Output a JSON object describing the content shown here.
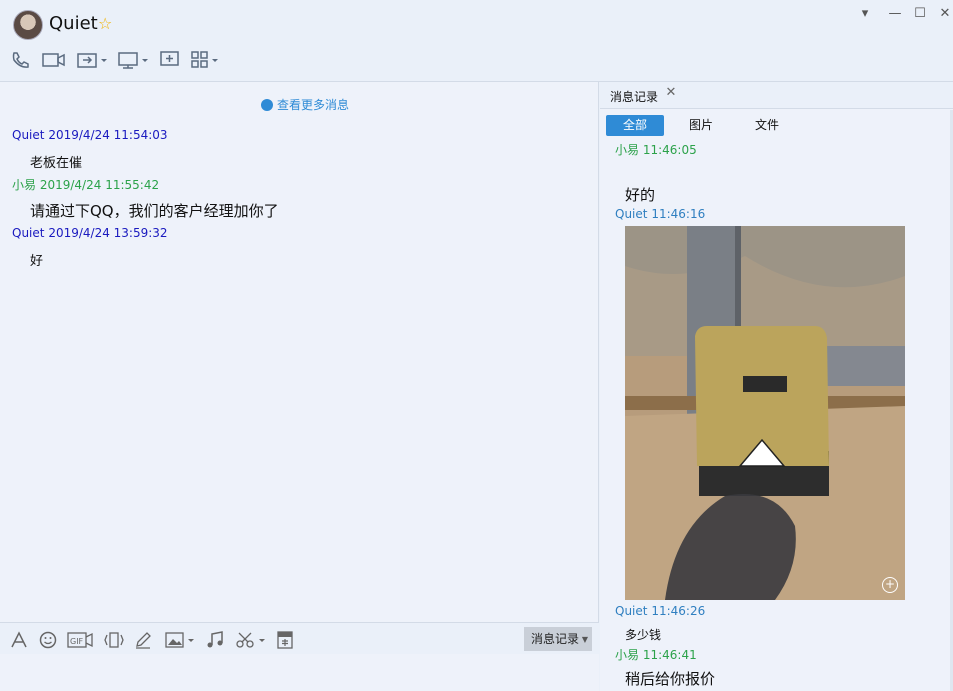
{
  "header": {
    "contact_name": "Quiet",
    "window_controls": [
      "chevron-down-icon",
      "minimize-icon",
      "maximize-icon",
      "close-icon"
    ],
    "toolbar_icons": [
      "phone-icon",
      "video-icon",
      "file-transfer-icon",
      "screen-share-icon",
      "add-chat-icon",
      "apps-icon"
    ]
  },
  "chat": {
    "more_messages": "查看更多消息",
    "messages": [
      {
        "sender": "Quiet",
        "time": "2019/4/24 11:54:03",
        "text": "老板在催"
      },
      {
        "sender": "小易",
        "time": "2019/4/24 11:55:42",
        "text": "请通过下QQ，我们的客户经理加你了"
      },
      {
        "sender": "Quiet",
        "time": "2019/4/24 13:59:32",
        "text": "好"
      }
    ]
  },
  "input_toolbar": {
    "icons": [
      "font-icon",
      "emoji-icon",
      "gif-icon",
      "shake-icon",
      "handwriting-icon",
      "image-icon",
      "music-icon",
      "screenshot-icon",
      "red-packet-icon"
    ],
    "history_label": "消息记录"
  },
  "panel": {
    "tab_label": "消息记录",
    "filters": [
      "全部",
      "图片",
      "文件"
    ],
    "active_filter": "全部",
    "entries": [
      {
        "sender": "小易",
        "time": "11:46:05",
        "text": ""
      },
      {
        "sender": "",
        "time": "",
        "text": "好的"
      },
      {
        "sender": "Quiet",
        "time": "11:46:16",
        "text": ""
      },
      {
        "sender": "Quiet",
        "time": "11:46:26",
        "text": "多少钱"
      },
      {
        "sender": "小易",
        "time": "11:46:41",
        "text": "稍后给你报价"
      }
    ]
  },
  "colors": {
    "accent": "#2f8bd6",
    "self_name": "#1a1abf",
    "other_name": "#2ca24a"
  }
}
